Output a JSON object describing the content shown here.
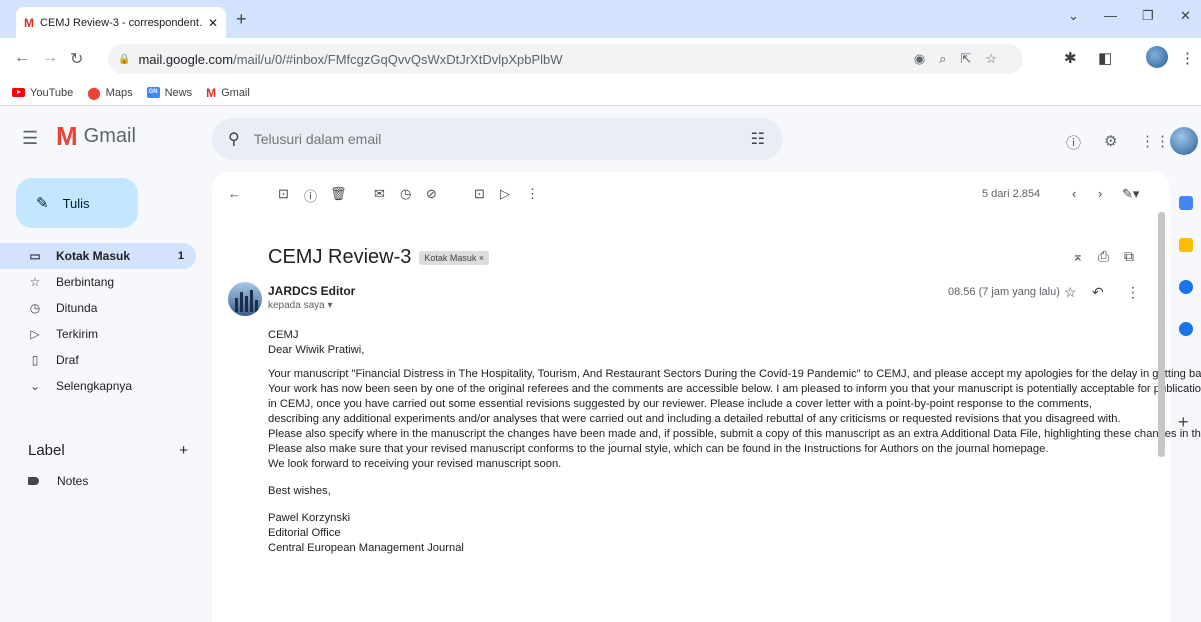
{
  "browser": {
    "tab_title": "CEMJ Review-3 - correspondent…",
    "tab_gmail_mark": "M",
    "tab_close": "✕",
    "new_tab": "+",
    "url_domain": "mail.google.com",
    "url_path": "/mail/u/0/#inbox/FMfcgzGqQvvQsWxDtJrXtDvlpXpbPlbW",
    "bookmarks": [
      {
        "label": "YouTube"
      },
      {
        "label": "Maps"
      },
      {
        "label": "News"
      },
      {
        "label": "Gmail"
      }
    ]
  },
  "gmail": {
    "logo_text": "Gmail",
    "search_placeholder": "Telusuri dalam email",
    "compose_label": "Tulis",
    "nav": [
      {
        "label": "Kotak Masuk",
        "count": "1"
      },
      {
        "label": "Berbintang"
      },
      {
        "label": "Ditunda"
      },
      {
        "label": "Terkirim"
      },
      {
        "label": "Draf"
      },
      {
        "label": "Selengkapnya"
      }
    ],
    "labels_title": "Label",
    "labels_add": "+",
    "labels": [
      "Notes"
    ],
    "pager": "5 dari 2.854"
  },
  "email": {
    "subject": "CEMJ Review-3",
    "chip": "Kotak Masuk ×",
    "sender": "JARDCS Editor",
    "to": "kepada saya ▾",
    "time": "08.56 (7 jam yang lalu)",
    "body": {
      "line1": "CEMJ",
      "line2": "Dear Wiwik Pratiwi,",
      "p1": "Your manuscript  \"Financial Distress in The Hospitality, Tourism, And Restaurant Sectors During the Covid-19 Pandemic\" to CEMJ, and please accept my apologies for the delay in getting back",
      "p2": "Your work has now been seen by  one of the original referees and the comments are accessible below. I am pleased to inform you that your manuscript is potentially acceptable for publication",
      "p3": "in CEMJ, once you have carried out some essential revisions suggested by our reviewer. Please include a cover letter with a point-by-point response to the comments,",
      "p4": "describing any additional experiments and/or analyses that were carried out and including a detailed rebuttal of any criticisms or requested revisions that you disagreed with.",
      "p5": "Please also specify where in the manuscript the changes  have been made and, if possible, submit a copy of this manuscript as an extra Additional Data File, highlighting these changes in the text.",
      "p6": "Please also make sure that your revised manuscript conforms to the journal style, which can be found in the Instructions for Authors on the journal homepage.",
      "p7": "We look forward to receiving your revised manuscript soon.",
      "wishes": "Best wishes,",
      "sig1": "Pawel Korzynski",
      "sig2": "Editorial Office",
      "sig3": "Central European Management Journal"
    }
  },
  "colors": {
    "gmail_red": "#ea4335",
    "compose_bg": "#c2e7ff",
    "active_nav_bg": "#d3e3fd",
    "tabstrip_bg": "#d3e3fd"
  }
}
